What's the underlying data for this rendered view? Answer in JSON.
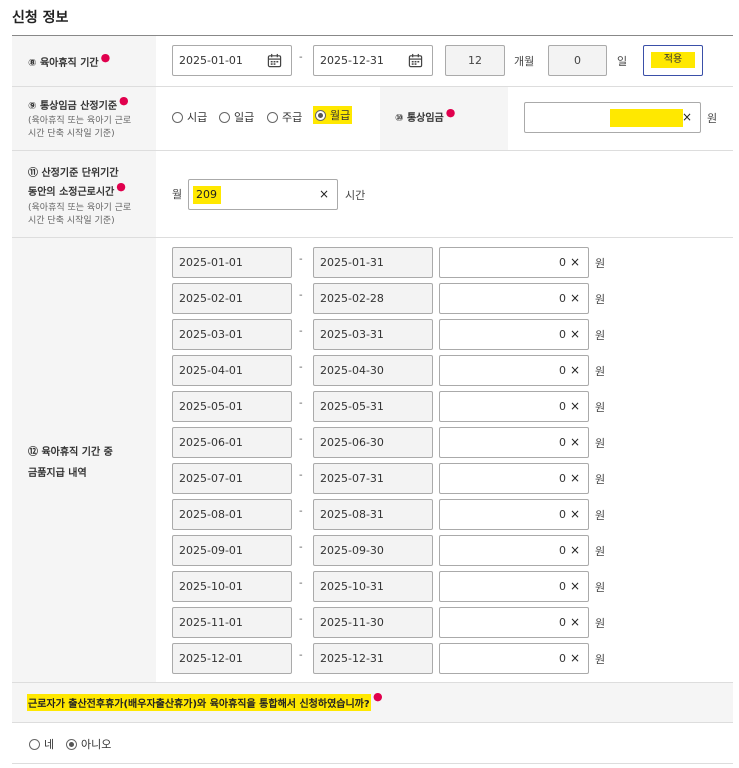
{
  "title": "신청 정보",
  "leave_period": {
    "label": "⑧ 육아휴직 기간",
    "start": "2025-01-01",
    "end": "2025-12-31",
    "sep": "-",
    "months": "12",
    "months_unit": "개월",
    "days": "0",
    "days_unit": "일",
    "apply_label": "적용"
  },
  "wage_basis": {
    "label": "⑨ 통상임금 산정기준",
    "note1": "(육아휴직 또는 육아기 근로",
    "note2": "시간 단축 시작일 기준)",
    "options": [
      "시급",
      "일급",
      "주급",
      "월급"
    ],
    "selected": "월급"
  },
  "ordinary_wage": {
    "label": "⑩ 통상임금",
    "value": "",
    "unit": "원",
    "clear": "×"
  },
  "work_hours": {
    "label1": "⑪ 산정기준 단위기간",
    "label2": "동안의 소정근로시간",
    "note1": "(육아휴직 또는 육아기 근로",
    "note2": "시간 단축 시작일 기준)",
    "prefix": "월",
    "value": "209",
    "unit": "시간",
    "clear": "×"
  },
  "payments": {
    "label1": "⑫ 육아휴직 기간 중",
    "label2": "금품지급 내역",
    "sep": "-",
    "unit": "원",
    "clear": "×",
    "rows": [
      {
        "start": "2025-01-01",
        "end": "2025-01-31",
        "amount": "0"
      },
      {
        "start": "2025-02-01",
        "end": "2025-02-28",
        "amount": "0"
      },
      {
        "start": "2025-03-01",
        "end": "2025-03-31",
        "amount": "0"
      },
      {
        "start": "2025-04-01",
        "end": "2025-04-30",
        "amount": "0"
      },
      {
        "start": "2025-05-01",
        "end": "2025-05-31",
        "amount": "0"
      },
      {
        "start": "2025-06-01",
        "end": "2025-06-30",
        "amount": "0"
      },
      {
        "start": "2025-07-01",
        "end": "2025-07-31",
        "amount": "0"
      },
      {
        "start": "2025-08-01",
        "end": "2025-08-31",
        "amount": "0"
      },
      {
        "start": "2025-09-01",
        "end": "2025-09-30",
        "amount": "0"
      },
      {
        "start": "2025-10-01",
        "end": "2025-10-31",
        "amount": "0"
      },
      {
        "start": "2025-11-01",
        "end": "2025-11-30",
        "amount": "0"
      },
      {
        "start": "2025-12-01",
        "end": "2025-12-31",
        "amount": "0"
      }
    ]
  },
  "integration_question": {
    "text": "근로자가 출산전후휴가(배우자출산휴가)와 육아휴직을 통합해서 신청하였습니까?",
    "options": [
      "네",
      "아니오"
    ],
    "selected": "아니오"
  },
  "colors": {
    "highlight": "#ffe800",
    "required_dot": "#e0004d",
    "apply_border": "#3a4fa8"
  }
}
